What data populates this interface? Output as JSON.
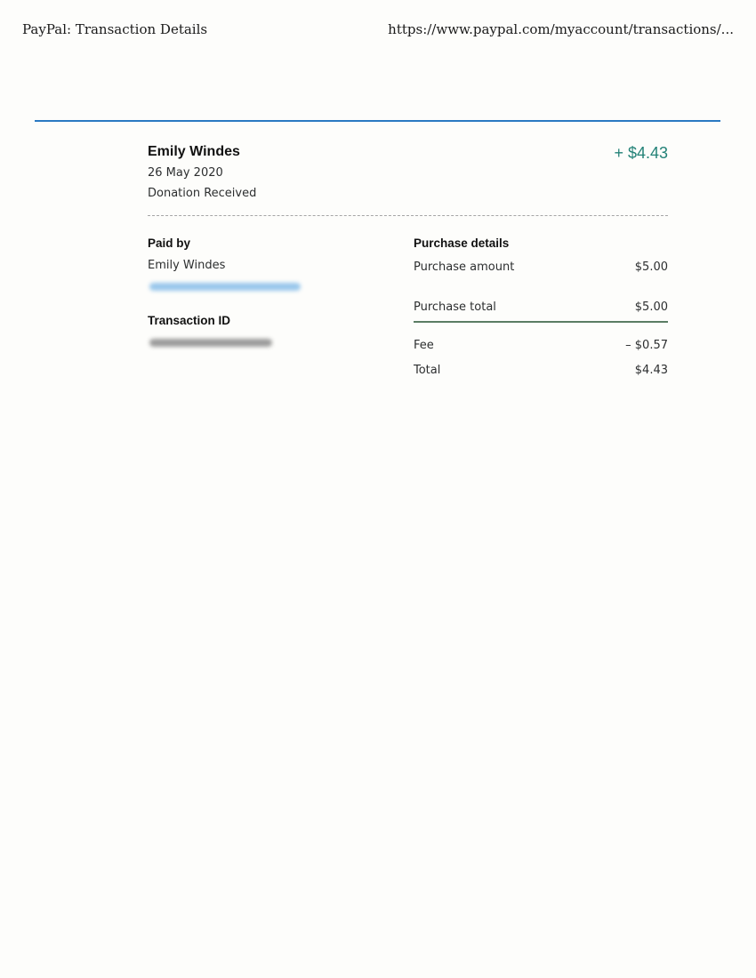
{
  "print_header": {
    "title": "PayPal: Transaction Details",
    "url": "https://www.paypal.com/myaccount/transactions/..."
  },
  "colors": {
    "accent_blue": "#2a79c2",
    "amount_green": "#238277",
    "rule_green": "#5b7d63"
  },
  "transaction": {
    "name": "Emily Windes",
    "date": "26 May 2020",
    "type": "Donation Received",
    "amount": "+ $4.43"
  },
  "paid_by": {
    "label": "Paid by",
    "name": "Emily Windes"
  },
  "transaction_id": {
    "label": "Transaction ID"
  },
  "purchase_details": {
    "label": "Purchase details",
    "rows": [
      {
        "label": "Purchase amount",
        "value": "$5.00"
      },
      {
        "label": "Purchase total",
        "value": "$5.00"
      },
      {
        "label": "Fee",
        "value": "– $0.57"
      },
      {
        "label": "Total",
        "value": "$4.43"
      }
    ]
  }
}
